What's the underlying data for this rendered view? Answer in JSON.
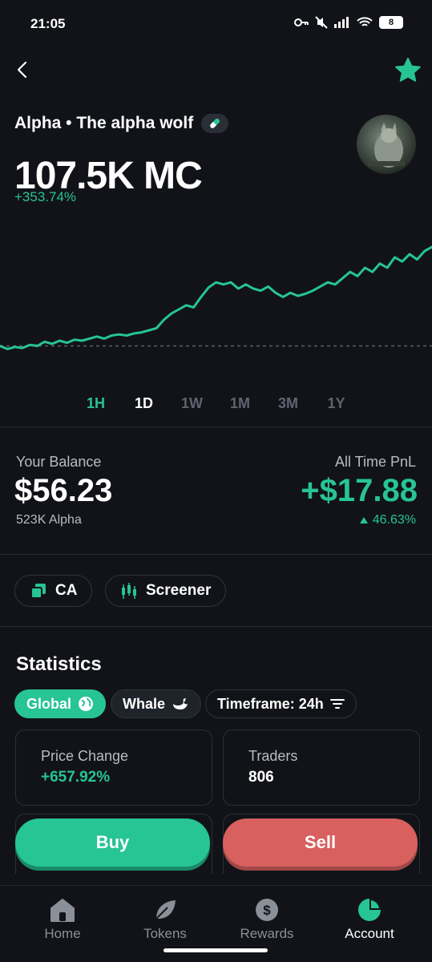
{
  "status": {
    "time": "21:05",
    "battery": "8"
  },
  "token": {
    "name": "Alpha • The alpha wolf",
    "market_cap": "107.5K MC",
    "change": "+353.74%"
  },
  "timeframes": [
    "1H",
    "1D",
    "1W",
    "1M",
    "3M",
    "1Y"
  ],
  "balance": {
    "label": "Your Balance",
    "value": "$56.23",
    "sub": "523K Alpha"
  },
  "pnl": {
    "label": "All Time PnL",
    "value": "+$17.88",
    "percent": "46.63%"
  },
  "chips": {
    "ca": "CA",
    "screener": "Screener"
  },
  "statistics": {
    "title": "Statistics",
    "filters": {
      "global": "Global",
      "whale": "Whale",
      "timeframe": "Timeframe: 24h"
    },
    "price_change": {
      "label": "Price Change",
      "value": "+657.92%"
    },
    "traders": {
      "label": "Traders",
      "value": "806"
    }
  },
  "actions": {
    "buy": "Buy",
    "sell": "Sell"
  },
  "tabs": {
    "home": "Home",
    "tokens": "Tokens",
    "rewards": "Rewards",
    "account": "Account"
  },
  "colors": {
    "accent": "#27c494",
    "sell": "#d8605f",
    "background": "#111318"
  },
  "chart_data": {
    "type": "line",
    "values": [
      0.05,
      0.02,
      0.04,
      0.03,
      0.06,
      0.05,
      0.09,
      0.07,
      0.1,
      0.08,
      0.11,
      0.1,
      0.12,
      0.14,
      0.12,
      0.15,
      0.16,
      0.15,
      0.17,
      0.18,
      0.2,
      0.22,
      0.3,
      0.36,
      0.4,
      0.44,
      0.42,
      0.52,
      0.61,
      0.66,
      0.64,
      0.66,
      0.6,
      0.64,
      0.6,
      0.58,
      0.62,
      0.56,
      0.52,
      0.56,
      0.53,
      0.55,
      0.58,
      0.62,
      0.66,
      0.64,
      0.7,
      0.76,
      0.72,
      0.8,
      0.76,
      0.84,
      0.8,
      0.9,
      0.86,
      0.93,
      0.88,
      0.96,
      1.0
    ],
    "baseline": 0.05
  }
}
